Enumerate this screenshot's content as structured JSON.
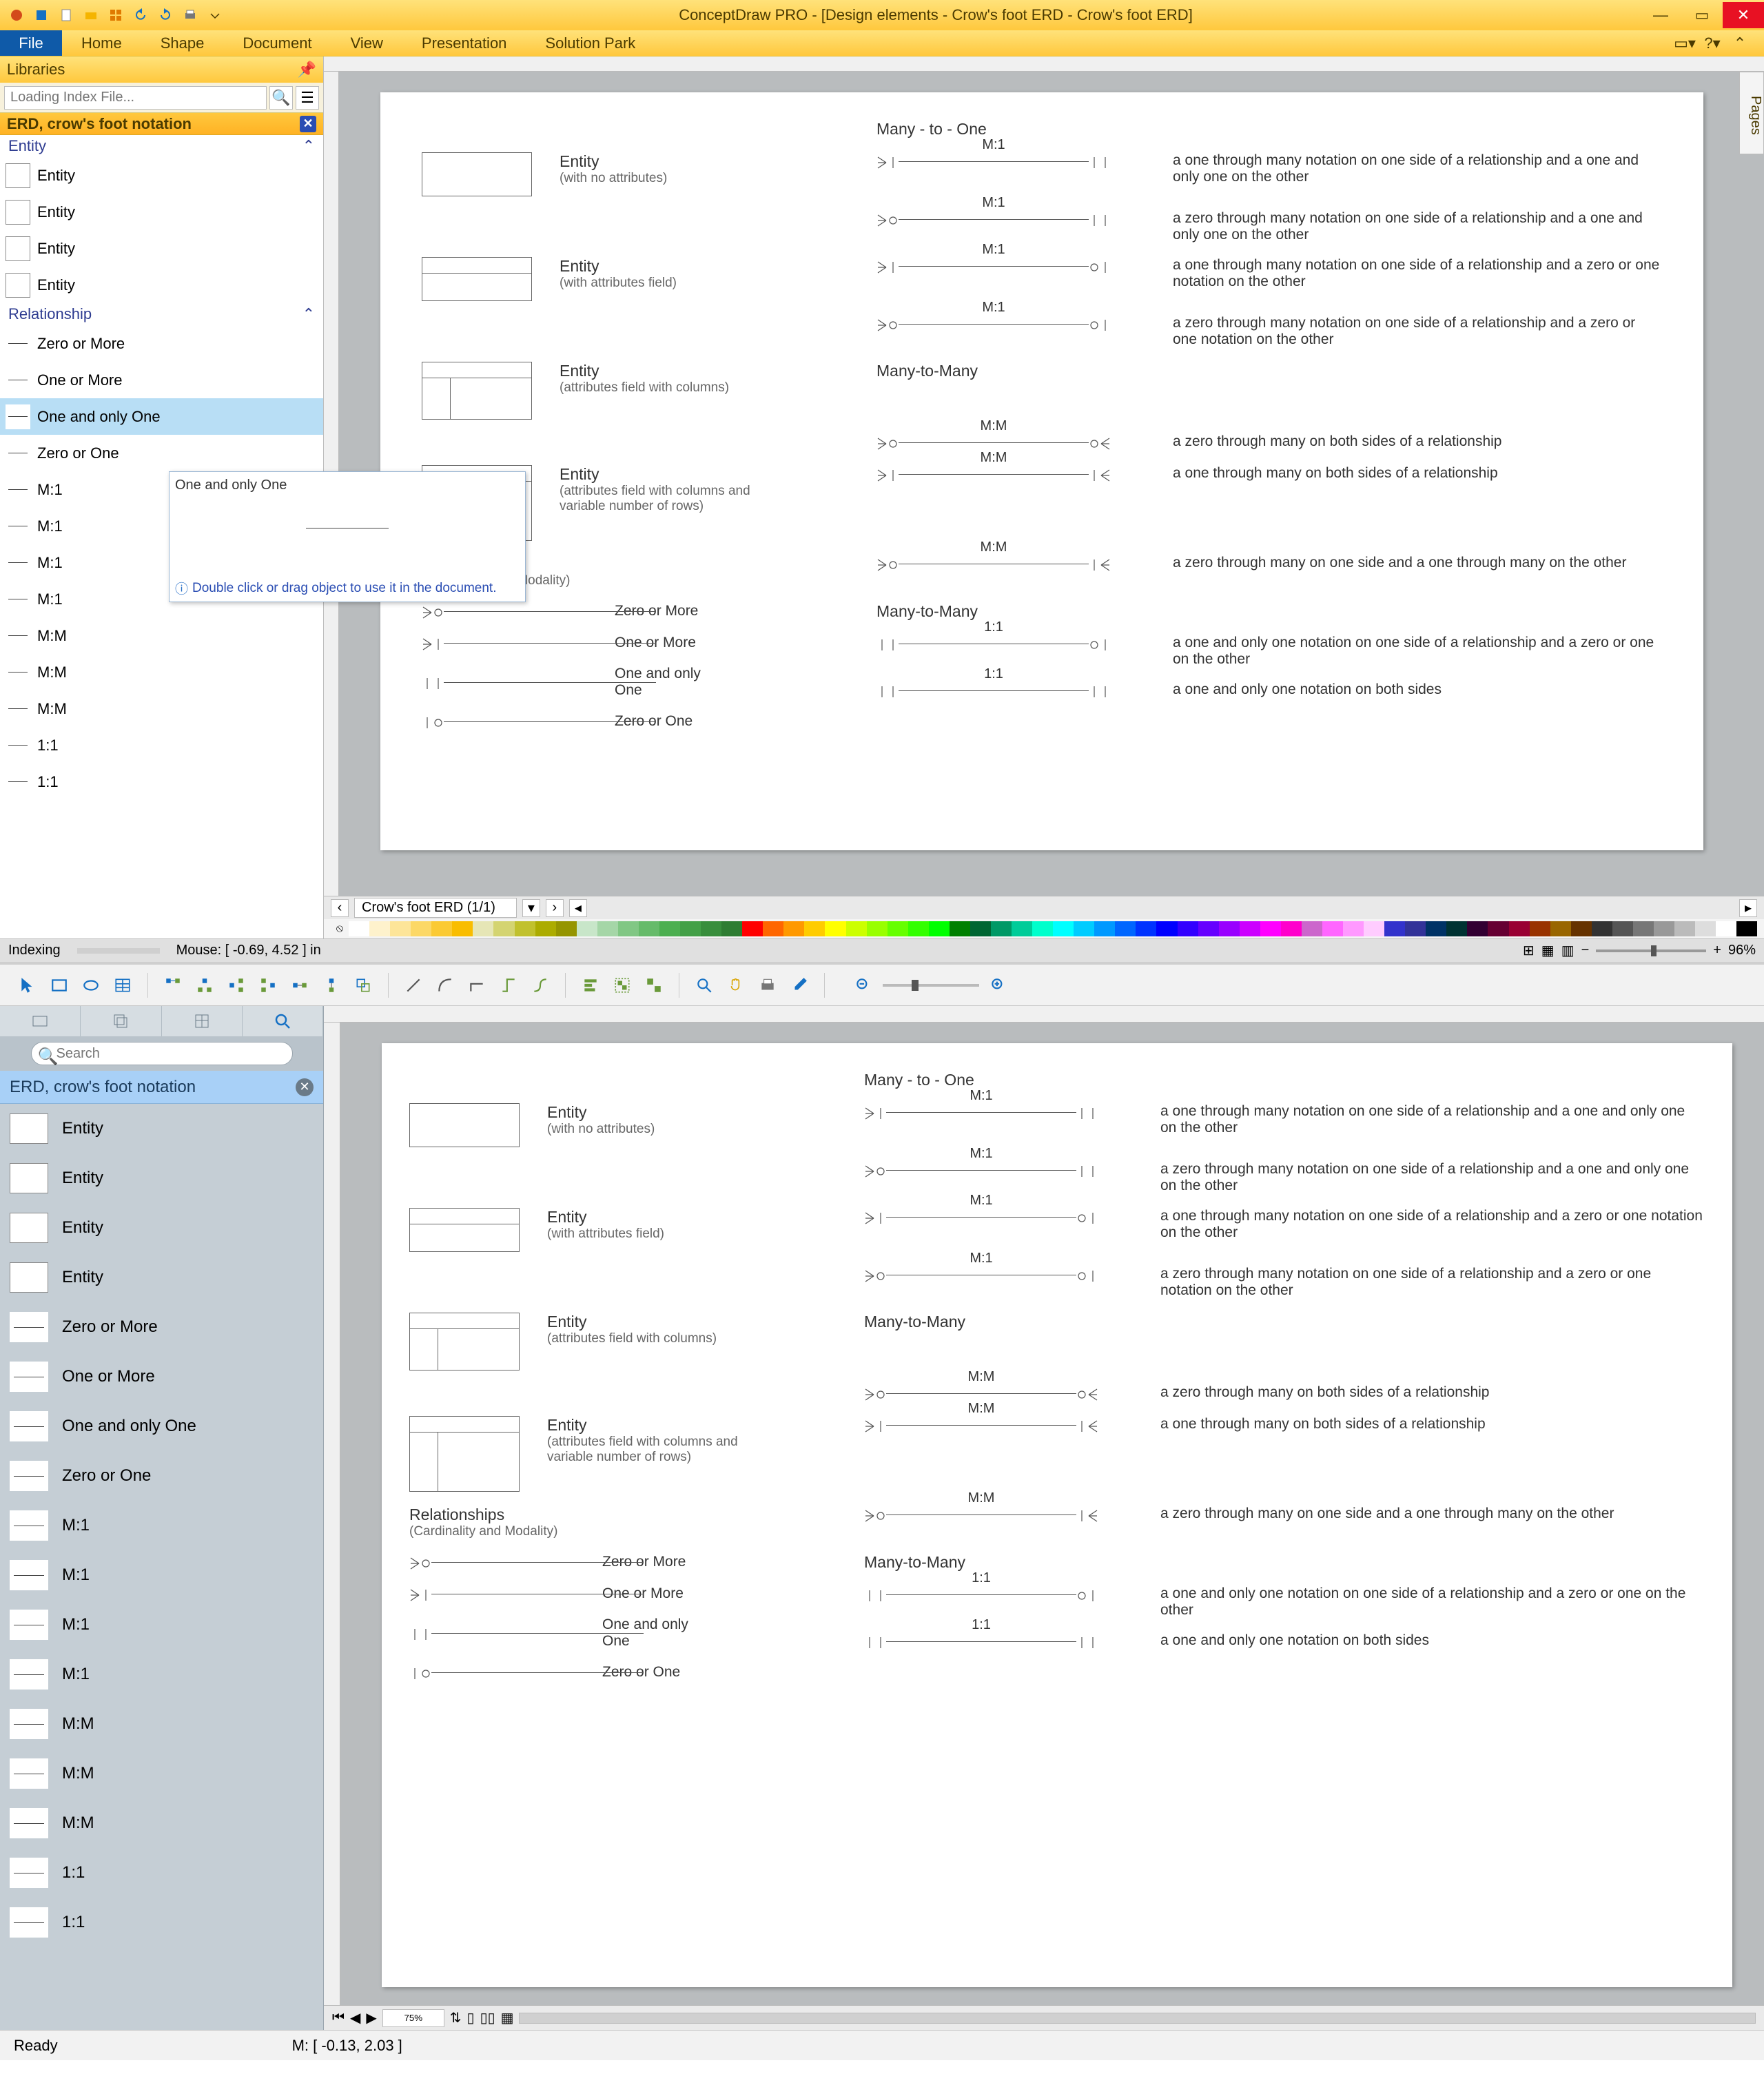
{
  "app1": {
    "title": "ConceptDraw PRO - [Design elements - Crow's foot ERD - Crow's foot ERD]",
    "ribbon": {
      "file": "File",
      "tabs": [
        "Home",
        "Shape",
        "Document",
        "View",
        "Presentation",
        "Solution Park"
      ]
    },
    "libraries": {
      "header": "Libraries",
      "search_placeholder": "Loading Index File...",
      "section": "ERD, crow's foot notation",
      "group_entity": "Entity",
      "group_relationship": "Relationship",
      "entity_items": [
        "Entity",
        "Entity",
        "Entity",
        "Entity"
      ],
      "rel_items": [
        "Zero or More",
        "One or More",
        "One and only One",
        "Zero or One",
        "M:1",
        "M:1",
        "M:1",
        "M:1",
        "M:M",
        "M:M",
        "M:M",
        "1:1",
        "1:1"
      ],
      "selected": "One and only One"
    },
    "tooltip": {
      "title": "One and only One",
      "hint": "Double click or drag object to use it in the document."
    },
    "doc_tab": "Crow's foot ERD (1/1)",
    "pages_tab": "Pages",
    "status": {
      "left": "Indexing",
      "mouse": "Mouse: [ -0.69, 4.52 ] in",
      "zoom": "96%"
    },
    "palette": [
      "#ffffff",
      "#fef2cc",
      "#fde599",
      "#fcd866",
      "#fbca33",
      "#f9bd00",
      "#e6e6b6",
      "#d4d471",
      "#c1c12d",
      "#acac00",
      "#959500",
      "#c8e6c9",
      "#a5d6a7",
      "#81c784",
      "#66bb6a",
      "#4caf50",
      "#43a047",
      "#388e3c",
      "#2e7d32",
      "#ff0000",
      "#ff6600",
      "#ff9900",
      "#ffcc00",
      "#ffff00",
      "#ccff00",
      "#99ff00",
      "#66ff00",
      "#33ff00",
      "#00ff00",
      "#008000",
      "#006633",
      "#009966",
      "#00cc99",
      "#00ffcc",
      "#00ffff",
      "#00ccff",
      "#0099ff",
      "#0066ff",
      "#0033ff",
      "#0000ff",
      "#3300ff",
      "#6600ff",
      "#9900ff",
      "#cc00ff",
      "#ff00ff",
      "#ff00cc",
      "#cc66cc",
      "#ff66ff",
      "#ff99ff",
      "#ffccff",
      "#3333cc",
      "#333399",
      "#003366",
      "#003333",
      "#330033",
      "#660033",
      "#990033",
      "#993300",
      "#996600",
      "#663300",
      "#333333",
      "#555555",
      "#777777",
      "#999999",
      "#bbbbbb",
      "#dddddd",
      "#ffffff",
      "#000000"
    ]
  },
  "app2": {
    "search_placeholder": "Search",
    "lib_header": "ERD, crow's foot notation",
    "items": [
      "Entity",
      "Entity",
      "Entity",
      "Entity",
      "Zero or More",
      "One or More",
      "One and only One",
      "Zero or One",
      "M:1",
      "M:1",
      "M:1",
      "M:1",
      "M:M",
      "M:M",
      "M:M",
      "1:1",
      "1:1"
    ],
    "bottom_zoom": "75%",
    "status_left": "Ready",
    "status_mouse": "M: [ -0.13, 2.03 ]"
  },
  "erd": {
    "many_to_one_hdg": "Many - to - One",
    "many_to_many_hdg": "Many-to-Many",
    "entity_label": "Entity",
    "entity_subs": {
      "none": "(with no attributes)",
      "attr": "(with attributes field)",
      "cols": "(attributes field with columns)",
      "rows": "(attributes field with columns and\nvariable number of rows)"
    },
    "relationships_hdg": "Relationships",
    "relationships_sub": "(Cardinality and Modality)",
    "card_items": [
      "Zero or More",
      "One or More",
      "One and only\nOne",
      "Zero or One"
    ],
    "m1_rows": [
      {
        "ratio": "M:1",
        "desc": "a one through many notation on one side of a relationship and a one and only one on the other"
      },
      {
        "ratio": "M:1",
        "desc": "a zero through many notation on one side of a relationship and a one and only one on the other"
      },
      {
        "ratio": "M:1",
        "desc": "a one through many notation on one side of a relationship and a zero or one notation on the other"
      },
      {
        "ratio": "M:1",
        "desc": "a zero through many notation on one side of a relationship and a zero or one notation on the other"
      }
    ],
    "mm_rows": [
      {
        "ratio": "M:M",
        "desc": "a zero through many on both sides of a relationship"
      },
      {
        "ratio": "M:M",
        "desc": "a one through many on both sides of a relationship"
      },
      {
        "ratio": "M:M",
        "desc": "a zero through many on one side and a one through many on the other"
      }
    ],
    "oo_rows": [
      {
        "ratio": "1:1",
        "desc": "a one and only one notation on one side of a relationship and a zero or one on the other"
      },
      {
        "ratio": "1:1",
        "desc": "a one and only one notation on both sides"
      }
    ]
  }
}
